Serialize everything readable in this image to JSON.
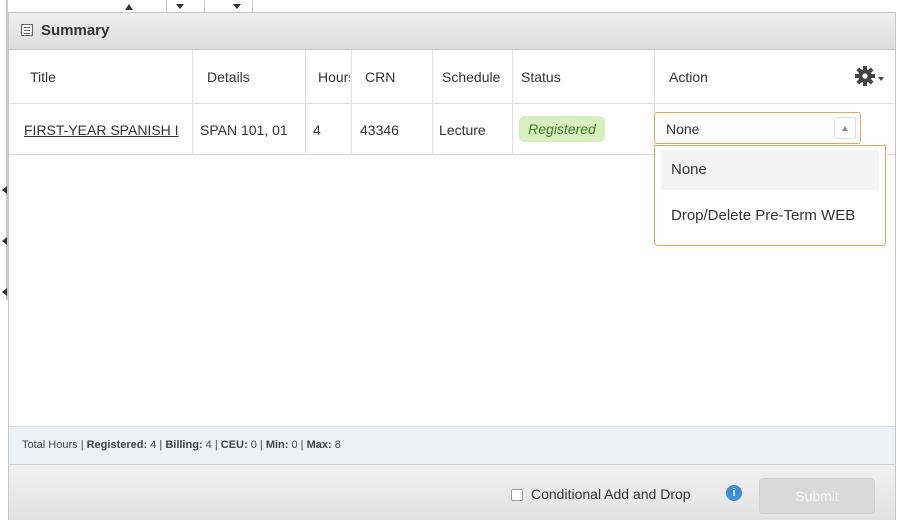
{
  "panel": {
    "title": "Summary",
    "icon": "table-icon"
  },
  "columns": [
    "Title",
    "Details",
    "Hours",
    "CRN",
    "Schedule",
    "Status",
    "Action"
  ],
  "settings_icon": "gear-icon",
  "row": {
    "title": "FIRST-YEAR SPANISH I",
    "details": "SPAN 101, 01",
    "hours": "4",
    "crn": "43346",
    "schedule": "Lecture",
    "status": "Registered",
    "action": "None"
  },
  "action_options": [
    "None",
    "Drop/Delete Pre-Term WEB"
  ],
  "totals": {
    "prefix": "Total Hours | ",
    "registered_label": "Registered:",
    "registered": "4",
    "billing_label": "Billing:",
    "billing": "4",
    "ceu_label": "CEU:",
    "ceu": "0",
    "min_label": "Min:",
    "min": "0",
    "max_label": "Max:",
    "max": "8"
  },
  "footer": {
    "conditional_label": "Conditional Add and Drop",
    "info_icon": "info-icon",
    "submit_label": "Submit"
  },
  "colors": {
    "accent_border": "#e8a65c",
    "status_bg": "#d8f0c0",
    "status_text": "#3a7d1e",
    "info": "#3d8fd9"
  }
}
